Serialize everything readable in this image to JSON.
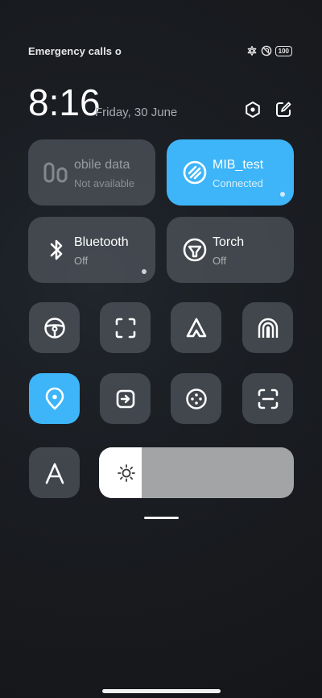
{
  "status": {
    "carrier_text": "Emergency calls o",
    "battery": "100",
    "icons": [
      "flower-icon",
      "no-sim-icon",
      "battery-icon"
    ]
  },
  "header": {
    "time": "8:16",
    "date": "Friday, 30 June",
    "actions": [
      "settings-icon",
      "edit-icon"
    ]
  },
  "tiles": {
    "mobile_data": {
      "title": "obile data",
      "subtitle": "Not available",
      "icon": "mobile-data-icon",
      "state": "disabled"
    },
    "wifi": {
      "title": "MIB_test",
      "subtitle": "Connected",
      "icon": "wifi-icon",
      "state": "on"
    },
    "bluetooth": {
      "title": "Bluetooth",
      "subtitle": "Off",
      "icon": "bluetooth-icon",
      "state": "off"
    },
    "torch": {
      "title": "Torch",
      "subtitle": "Off",
      "icon": "torch-icon",
      "state": "off"
    }
  },
  "small_tiles": [
    {
      "name": "driving-mode",
      "icon": "steering-wheel-icon",
      "active": false
    },
    {
      "name": "screenshot",
      "icon": "screenshot-icon",
      "active": false
    },
    {
      "name": "reading-mode",
      "icon": "triangle-icon",
      "active": false
    },
    {
      "name": "nfc",
      "icon": "nfc-icon",
      "active": false
    },
    {
      "name": "location",
      "icon": "location-icon",
      "active": true
    },
    {
      "name": "cast",
      "icon": "cast-icon",
      "active": false
    },
    {
      "name": "hotspot",
      "icon": "dots-circle-icon",
      "active": false
    },
    {
      "name": "scanner",
      "icon": "scanner-icon",
      "active": false
    }
  ],
  "auto_brightness": {
    "icon": "auto-brightness-icon",
    "label": "A"
  },
  "brightness": {
    "level": 0.22,
    "icon": "sun-icon"
  },
  "colors": {
    "accent": "#3db5f8",
    "tile_bg": "#5a6068",
    "slider_track": "#a3a4a6"
  }
}
